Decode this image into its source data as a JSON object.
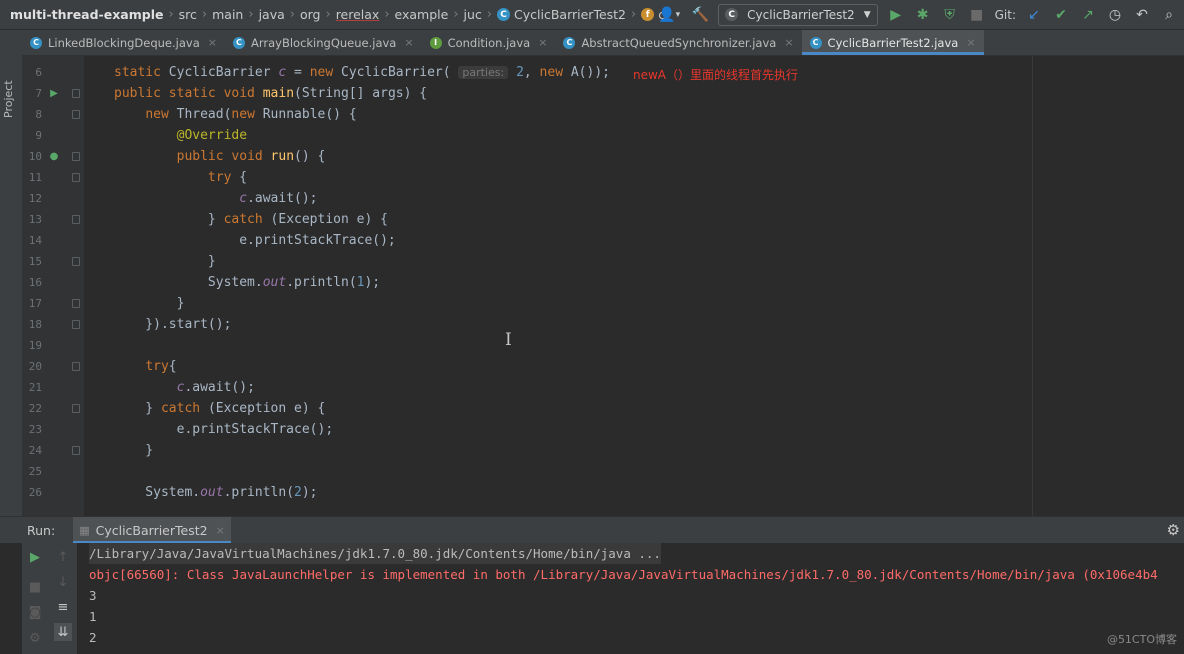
{
  "breadcrumbs": [
    "multi-thread-example",
    "src",
    "main",
    "java",
    "org",
    "rerelax",
    "example",
    "juc",
    "CyclicBarrierTest2",
    "c"
  ],
  "run_config": "CyclicBarrierTest2",
  "git_label": "Git:",
  "project_label": "Project",
  "tabs": [
    {
      "label": "LinkedBlockingDeque.java",
      "icon_color": "#3592c4",
      "icon": "C"
    },
    {
      "label": "ArrayBlockingQueue.java",
      "icon_color": "#3592c4",
      "icon": "C"
    },
    {
      "label": "Condition.java",
      "icon_color": "#5e9b3f",
      "icon": "I"
    },
    {
      "label": "AbstractQueuedSynchronizer.java",
      "icon_color": "#3592c4",
      "icon": "C"
    },
    {
      "label": "CyclicBarrierTest2.java",
      "icon_color": "#3592c4",
      "icon": "C",
      "active": true
    }
  ],
  "editor": {
    "annotation_note": "newA（）里面的线程首先执行",
    "param_hint": "parties:",
    "lines": [
      {
        "n": "6"
      },
      {
        "n": "7"
      },
      {
        "n": "8"
      },
      {
        "n": "9"
      },
      {
        "n": "10"
      },
      {
        "n": "11"
      },
      {
        "n": "12"
      },
      {
        "n": "13"
      },
      {
        "n": "14"
      },
      {
        "n": "15"
      },
      {
        "n": "16"
      },
      {
        "n": "17"
      },
      {
        "n": "18"
      },
      {
        "n": "19"
      },
      {
        "n": "20"
      },
      {
        "n": "21"
      },
      {
        "n": "22"
      },
      {
        "n": "23"
      },
      {
        "n": "24"
      },
      {
        "n": "25"
      },
      {
        "n": "26"
      }
    ]
  },
  "run": {
    "label": "Run:",
    "tab_label": "CyclicBarrierTest2",
    "console": [
      "/Library/Java/JavaVirtualMachines/jdk1.7.0_80.jdk/Contents/Home/bin/java ...",
      "objc[66560]: Class JavaLaunchHelper is implemented in both /Library/Java/JavaVirtualMachines/jdk1.7.0_80.jdk/Contents/Home/bin/java (0x106e4b4",
      "3",
      "1",
      "2"
    ]
  },
  "watermark": "@51CTO博客",
  "colors": {
    "accent": "#4a88c7",
    "error": "#ff6b68",
    "note": "#e8372c",
    "keyword": "#cc7832"
  }
}
